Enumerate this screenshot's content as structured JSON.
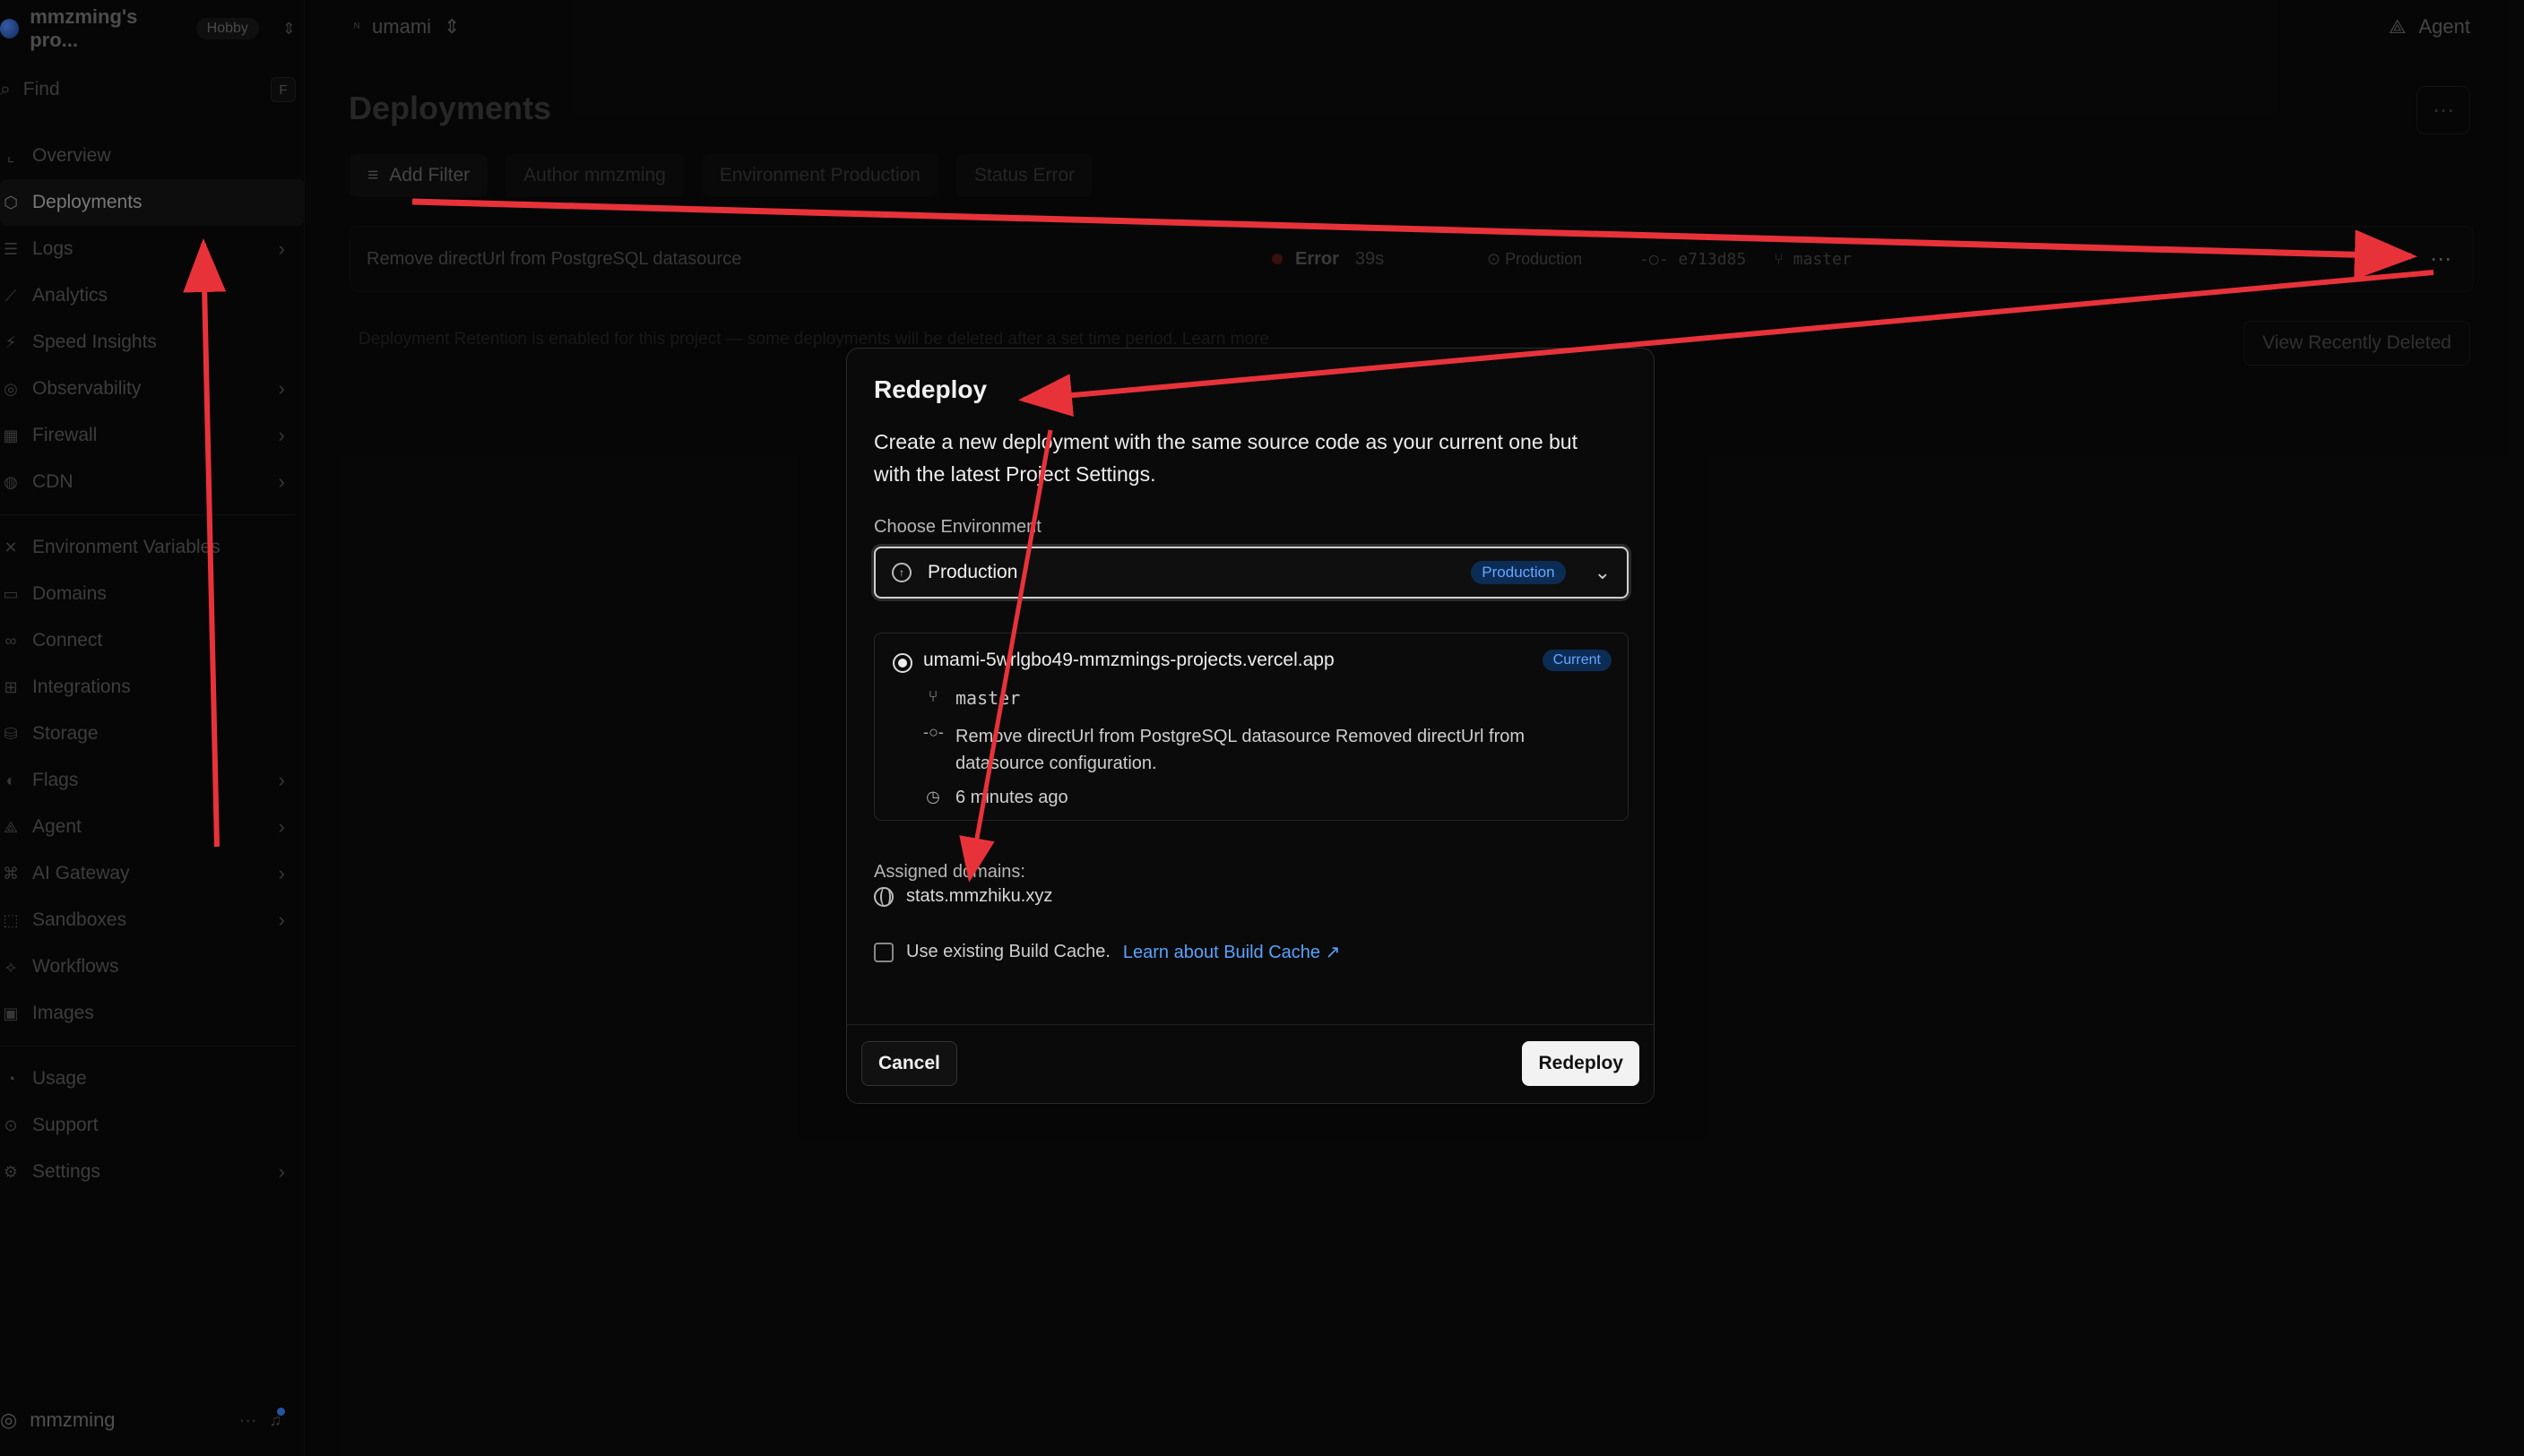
{
  "team": {
    "name": "mmzming's pro...",
    "plan": "Hobby"
  },
  "project": {
    "name": "umami"
  },
  "agent_label": "Agent",
  "find": {
    "placeholder": "Find",
    "shortcut": "F"
  },
  "sidebar": {
    "items": [
      {
        "label": "Overview",
        "icon": "overview-icon"
      },
      {
        "label": "Deployments",
        "icon": "deployments-icon",
        "active": true
      },
      {
        "label": "Logs",
        "icon": "logs-icon",
        "chevron": true
      },
      {
        "label": "Analytics",
        "icon": "analytics-icon"
      },
      {
        "label": "Speed Insights",
        "icon": "speed-insights-icon"
      },
      {
        "label": "Observability",
        "icon": "observability-icon",
        "chevron": true
      },
      {
        "label": "Firewall",
        "icon": "firewall-icon",
        "chevron": true
      },
      {
        "label": "CDN",
        "icon": "globe-icon",
        "chevron": true
      },
      {
        "label": "Environment Variables",
        "icon": "env-vars-icon"
      },
      {
        "label": "Domains",
        "icon": "domains-icon"
      },
      {
        "label": "Connect",
        "icon": "connect-icon"
      },
      {
        "label": "Integrations",
        "icon": "integrations-icon"
      },
      {
        "label": "Storage",
        "icon": "storage-icon"
      },
      {
        "label": "Flags",
        "icon": "flags-icon",
        "chevron": true
      },
      {
        "label": "Agent",
        "icon": "agent-icon",
        "chevron": true
      },
      {
        "label": "AI Gateway",
        "icon": "ai-gateway-icon",
        "chevron": true
      },
      {
        "label": "Sandboxes",
        "icon": "sandboxes-icon",
        "chevron": true
      },
      {
        "label": "Workflows",
        "icon": "workflows-icon"
      },
      {
        "label": "Images",
        "icon": "images-icon"
      },
      {
        "label": "Usage",
        "icon": "usage-icon"
      },
      {
        "label": "Support",
        "icon": "support-icon"
      },
      {
        "label": "Settings",
        "icon": "settings-icon",
        "chevron": true
      }
    ]
  },
  "user": {
    "name": "mmzming"
  },
  "page": {
    "title": "Deployments"
  },
  "filters": {
    "add": "Add Filter",
    "author": "Author mmzming",
    "environment": "Environment Production",
    "status": "Status Error"
  },
  "deployment_row": {
    "title": "Remove directUrl from PostgreSQL datasource",
    "status": "Error",
    "duration": "39s",
    "environment": "Production",
    "commit": "e713d85",
    "branch": "master"
  },
  "retention_text": "Deployment Retention is enabled for this project — some deployments will be deleted after a set time period. Learn more",
  "view_recently_deleted": "View Recently Deleted",
  "modal": {
    "title": "Redeploy",
    "description": "Create a new deployment with the same source code as your current one but with the latest Project Settings.",
    "choose_env_label": "Choose Environment",
    "env_value": "Production",
    "env_badge": "Production",
    "deployment": {
      "url": "umami-5wrlgbo49-mmzmings-projects.vercel.app",
      "badge": "Current",
      "branch": "master",
      "commit_message": "Remove directUrl from PostgreSQL datasource Removed directUrl from datasource configuration.",
      "age": "6 minutes ago"
    },
    "assigned_domains_label": "Assigned domains:",
    "domain": "stats.mmzhiku.xyz",
    "cache_label": "Use existing Build Cache.",
    "cache_link": "Learn about Build Cache",
    "cancel": "Cancel",
    "redeploy": "Redeploy"
  },
  "colors": {
    "annotation_arrow": "#e8323a",
    "badge_bg": "#0b2c54",
    "badge_text": "#66a6ff",
    "link": "#5aa2ff"
  }
}
